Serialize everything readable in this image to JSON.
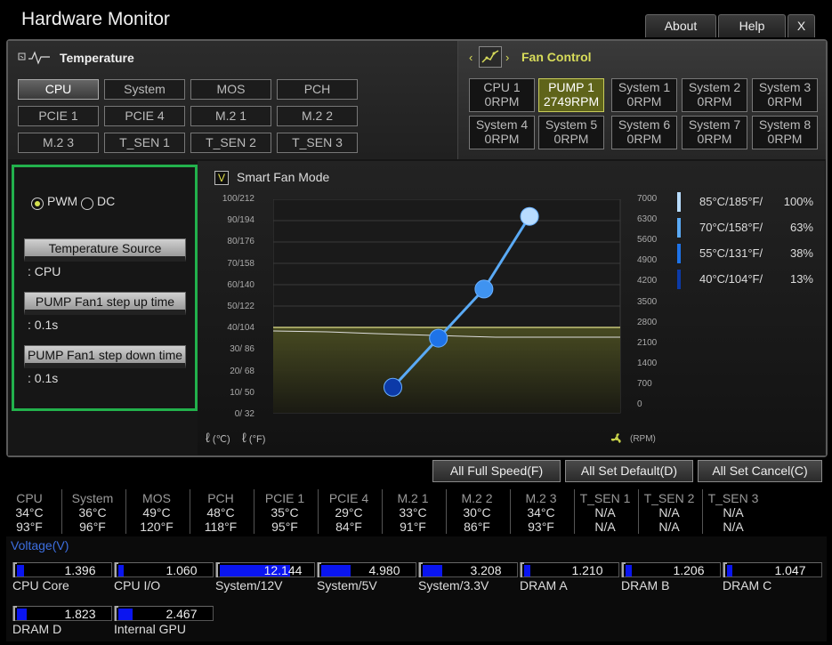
{
  "app": {
    "title": "Hardware Monitor",
    "about": "About",
    "help": "Help",
    "close": "X"
  },
  "temperature": {
    "header": "Temperature",
    "tabs": [
      "CPU",
      "System",
      "MOS",
      "PCH",
      "PCIE 1",
      "PCIE 4",
      "M.2 1",
      "M.2 2",
      "M.2 3",
      "T_SEN 1",
      "T_SEN 2",
      "T_SEN 3"
    ],
    "active": "CPU"
  },
  "fan_control": {
    "header": "Fan Control",
    "fans": [
      {
        "name": "CPU 1",
        "rpm": "0RPM"
      },
      {
        "name": "PUMP 1",
        "rpm": "2749RPM",
        "active": true
      },
      {
        "name": "System 1",
        "rpm": "0RPM"
      },
      {
        "name": "System 2",
        "rpm": "0RPM"
      },
      {
        "name": "System 3",
        "rpm": "0RPM"
      },
      {
        "name": "System 4",
        "rpm": "0RPM"
      },
      {
        "name": "System 5",
        "rpm": "0RPM"
      },
      {
        "name": "System 6",
        "rpm": "0RPM"
      },
      {
        "name": "System 7",
        "rpm": "0RPM"
      },
      {
        "name": "System 8",
        "rpm": "0RPM"
      }
    ]
  },
  "settings": {
    "pwm": "PWM",
    "dc": "DC",
    "mode_selected": "PWM",
    "temp_source_label": "Temperature Source",
    "temp_source_value": ": CPU",
    "step_up_label": "PUMP Fan1 step up time",
    "step_up_value": ": 0.1s",
    "step_down_label": "PUMP Fan1 step down time",
    "step_down_value": ": 0.1s"
  },
  "smart_fan": {
    "label": "Smart Fan Mode",
    "checked": true,
    "check_glyph": "V"
  },
  "chart_data": {
    "type": "line",
    "y_left_ticks": [
      "100/212",
      "90/194",
      "80/176",
      "70/158",
      "60/140",
      "50/122",
      "40/104",
      "30/ 86",
      "20/ 68",
      "10/ 50",
      "0/ 32"
    ],
    "y_right_ticks": [
      "7000",
      "6300",
      "5600",
      "4900",
      "4200",
      "3500",
      "2800",
      "2100",
      "1400",
      "700",
      "0"
    ],
    "x_unit_c": "(℃)",
    "x_unit_f": "(°F)",
    "right_unit": "(RPM)",
    "curve_points": [
      {
        "temp_c": 40,
        "fan_pct": 13
      },
      {
        "temp_c": 55,
        "fan_pct": 38
      },
      {
        "temp_c": 70,
        "fan_pct": 63
      },
      {
        "temp_c": 85,
        "fan_pct": 100
      }
    ],
    "current_rpm_level": 2800,
    "legend": [
      {
        "temp": "85°C/185°F/",
        "pct": "100%",
        "color": "#b8dcff"
      },
      {
        "temp": "70°C/158°F/",
        "pct": "63%",
        "color": "#5aaaf5"
      },
      {
        "temp": "55°C/131°F/",
        "pct": "38%",
        "color": "#1e73e8"
      },
      {
        "temp": "40°C/104°F/",
        "pct": "13%",
        "color": "#0c3aa8"
      }
    ]
  },
  "actions": {
    "full_speed": "All Full Speed(F)",
    "set_default": "All Set Default(D)",
    "set_cancel": "All Set Cancel(C)"
  },
  "temps": [
    {
      "name": "CPU",
      "c": "34°C",
      "f": "93°F"
    },
    {
      "name": "System",
      "c": "36°C",
      "f": "96°F"
    },
    {
      "name": "MOS",
      "c": "49°C",
      "f": "120°F"
    },
    {
      "name": "PCH",
      "c": "48°C",
      "f": "118°F"
    },
    {
      "name": "PCIE 1",
      "c": "35°C",
      "f": "95°F"
    },
    {
      "name": "PCIE 4",
      "c": "29°C",
      "f": "84°F"
    },
    {
      "name": "M.2 1",
      "c": "33°C",
      "f": "91°F"
    },
    {
      "name": "M.2 2",
      "c": "30°C",
      "f": "86°F"
    },
    {
      "name": "M.2 3",
      "c": "34°C",
      "f": "93°F"
    },
    {
      "name": "T_SEN 1",
      "c": "N/A",
      "f": "N/A"
    },
    {
      "name": "T_SEN 2",
      "c": "N/A",
      "f": "N/A"
    },
    {
      "name": "T_SEN 3",
      "c": "N/A",
      "f": "N/A"
    }
  ],
  "voltage": {
    "title": "Voltage(V)",
    "items": [
      {
        "name": "CPU Core",
        "value": "1.396",
        "fill": 0.09
      },
      {
        "name": "CPU I/O",
        "value": "1.060",
        "fill": 0.07
      },
      {
        "name": "System/12V",
        "value": "12.144",
        "fill": 0.9
      },
      {
        "name": "System/5V",
        "value": "4.980",
        "fill": 0.37
      },
      {
        "name": "System/3.3V",
        "value": "3.208",
        "fill": 0.25
      },
      {
        "name": "DRAM A",
        "value": "1.210",
        "fill": 0.08
      },
      {
        "name": "DRAM B",
        "value": "1.206",
        "fill": 0.08
      },
      {
        "name": "DRAM C",
        "value": "1.047",
        "fill": 0.07
      },
      {
        "name": "DRAM D",
        "value": "1.823",
        "fill": 0.12
      },
      {
        "name": "Internal GPU",
        "value": "2.467",
        "fill": 0.18
      }
    ]
  }
}
